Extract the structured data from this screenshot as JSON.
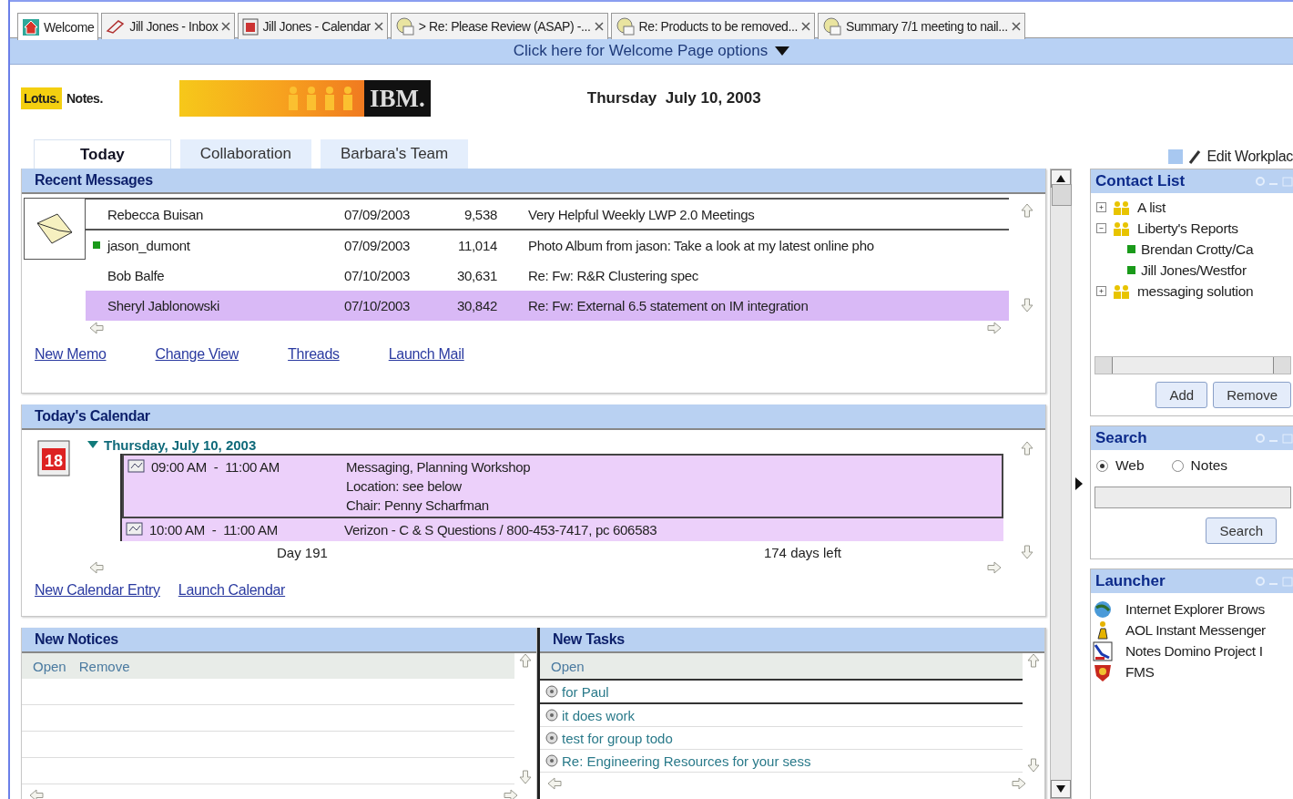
{
  "doc_tabs": [
    {
      "label": "Welcome",
      "closable": false,
      "selected": true
    },
    {
      "label": "Jill Jones - Inbox",
      "closable": true,
      "selected": false
    },
    {
      "label": "Jill Jones - Calendar",
      "closable": true,
      "selected": false
    },
    {
      "label": "> Re: Please Review (ASAP) -...",
      "closable": true,
      "selected": false
    },
    {
      "label": "Re: Products to be removed...",
      "closable": true,
      "selected": false
    },
    {
      "label": "Summary 7/1 meeting to nail...",
      "closable": true,
      "selected": false
    }
  ],
  "options_bar": {
    "label": "Click here for Welcome Page options"
  },
  "header": {
    "brand": "Lotus.",
    "product": "Notes.",
    "banner_text": "IBM.",
    "date": "Thursday  July 10, 2003"
  },
  "page_tabs": [
    {
      "label": "Today",
      "selected": true
    },
    {
      "label": "Collaboration",
      "selected": false
    },
    {
      "label": "Barbara's Team",
      "selected": false
    }
  ],
  "edit_workplace": "Edit Workplac",
  "recent_messages": {
    "title": "Recent Messages",
    "rows": [
      {
        "sender": "Rebecca Buisan",
        "date": "07/09/2003",
        "size": "9,538",
        "subject": "Very Helpful Weekly LWP 2.0 Meetings",
        "online": false,
        "selected": false
      },
      {
        "sender": "jason_dumont",
        "date": "07/09/2003",
        "size": "11,014",
        "subject": "Photo Album from jason: Take a look at my latest online pho",
        "online": true,
        "selected": false
      },
      {
        "sender": "Bob Balfe",
        "date": "07/10/2003",
        "size": "30,631",
        "subject": "Re: Fw: R&R Clustering spec",
        "online": false,
        "selected": false
      },
      {
        "sender": "Sheryl Jablonowski",
        "date": "07/10/2003",
        "size": "30,842",
        "subject": "Re: Fw: External 6.5 statement on IM integration",
        "online": false,
        "selected": true
      }
    ],
    "links": [
      "New Memo",
      "Change View",
      "Threads",
      "Launch Mail"
    ]
  },
  "calendar": {
    "title": "Today's Calendar",
    "icon_day": "18",
    "day_heading": "Thursday, July 10, 2003",
    "expanded": true,
    "entries": [
      {
        "time": "09:00 AM  -  11:00 AM",
        "lines": [
          "Messaging, Planning Workshop",
          "Location: see below",
          "Chair: Penny Scharfman"
        ],
        "selected": true
      },
      {
        "time": "10:00 AM  -  11:00 AM",
        "lines": [
          "Verizon - C & S Questions / 800-453-7417, pc 606583"
        ],
        "selected": false
      }
    ],
    "day_number": "Day 191",
    "days_left": "174 days left",
    "links": [
      "New Calendar Entry",
      "Launch Calendar"
    ]
  },
  "notices": {
    "title": "New Notices",
    "actions": [
      "Open",
      "Remove"
    ]
  },
  "tasks": {
    "title": "New Tasks",
    "actions": [
      "Open"
    ],
    "items": [
      {
        "label": "for Paul",
        "selected": true
      },
      {
        "label": "it does work",
        "selected": false
      },
      {
        "label": "test for group todo",
        "selected": false
      },
      {
        "label": "Re: Engineering Resources for your sess",
        "selected": false
      }
    ]
  },
  "contact_list": {
    "title": "Contact List",
    "tree": [
      {
        "label": "A list",
        "expanded": false
      },
      {
        "label": "Liberty's Reports",
        "expanded": true,
        "children": [
          {
            "label": "Brendan Crotty/Ca",
            "online": true
          },
          {
            "label": "Jill Jones/Westfor",
            "online": true
          }
        ]
      },
      {
        "label": "messaging solution",
        "expanded": false
      }
    ],
    "buttons": [
      "Add",
      "Remove"
    ]
  },
  "search": {
    "title": "Search",
    "options": [
      {
        "label": "Web",
        "selected": true
      },
      {
        "label": "Notes",
        "selected": false
      }
    ],
    "button": "Search"
  },
  "launcher": {
    "title": "Launcher",
    "items": [
      {
        "label": "Internet Explorer Brows"
      },
      {
        "label": "AOL Instant Messenger"
      },
      {
        "label": "Notes Domino Project I"
      },
      {
        "label": "FMS"
      }
    ]
  }
}
